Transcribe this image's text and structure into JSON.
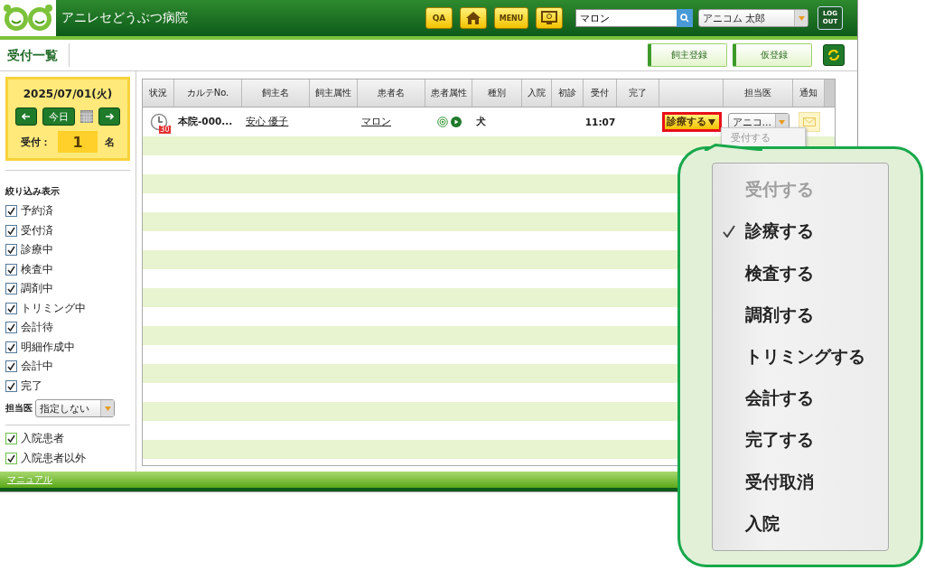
{
  "header": {
    "clinic_name": "アニレセどうぶつ病院",
    "qa_button": "QA",
    "menu_button": "MENU",
    "search": {
      "value": "マロン"
    },
    "user_select": {
      "value": "アニコム 太郎"
    },
    "logout_button": "LOG OUT"
  },
  "page": {
    "title": "受付一覧",
    "buttons": [
      "飼主登録",
      "仮登録"
    ]
  },
  "date_panel": {
    "date": "2025/07/01(火)",
    "today_button": "今日",
    "reception_label": "受付：",
    "count": "1",
    "unit": "名"
  },
  "filters": {
    "title": "絞り込み表示",
    "items": [
      {
        "label": "予約済",
        "checked": true
      },
      {
        "label": "受付済",
        "checked": true
      },
      {
        "label": "診療中",
        "checked": true
      },
      {
        "label": "検査中",
        "checked": true
      },
      {
        "label": "調剤中",
        "checked": true
      },
      {
        "label": "トリミング中",
        "checked": true
      },
      {
        "label": "会計待",
        "checked": true
      },
      {
        "label": "明細作成中",
        "checked": true
      },
      {
        "label": "会計中",
        "checked": true
      },
      {
        "label": "完了",
        "checked": true
      }
    ],
    "doctor_label": "担当医",
    "doctor_select": "指定しない",
    "inpatient_items": [
      {
        "label": "入院患者",
        "checked": true
      },
      {
        "label": "入院患者以外",
        "checked": true
      }
    ]
  },
  "table": {
    "columns": [
      "状況",
      "カルテNo.",
      "飼主名",
      "飼主属性",
      "患者名",
      "患者属性",
      "種別",
      "入院",
      "初診",
      "受付",
      "完了",
      "",
      "担当医",
      "通知"
    ],
    "rows": [
      {
        "status_badge": "30",
        "chart_no": "本院-000...",
        "owner_name": "安心 優子",
        "patient_name": "マロン",
        "species": "犬",
        "reception_time": "11:07",
        "action": "診療する",
        "doctor": "アニコ..."
      }
    ]
  },
  "small_dropdown": {
    "items": [
      {
        "label": "受付する",
        "disabled": true
      }
    ]
  },
  "footer": {
    "link": "マニュアル"
  },
  "callout_menu": {
    "items": [
      {
        "label": "受付する",
        "disabled": true,
        "selected": false
      },
      {
        "label": "診療する",
        "disabled": false,
        "selected": true
      },
      {
        "label": "検査する",
        "disabled": false,
        "selected": false
      },
      {
        "label": "調剤する",
        "disabled": false,
        "selected": false
      },
      {
        "label": "トリミングする",
        "disabled": false,
        "selected": false
      },
      {
        "label": "会計する",
        "disabled": false,
        "selected": false
      },
      {
        "label": "完了する",
        "disabled": false,
        "selected": false
      },
      {
        "label": "受付取消",
        "disabled": false,
        "selected": false
      },
      {
        "label": "入院",
        "disabled": false,
        "selected": false
      }
    ]
  }
}
